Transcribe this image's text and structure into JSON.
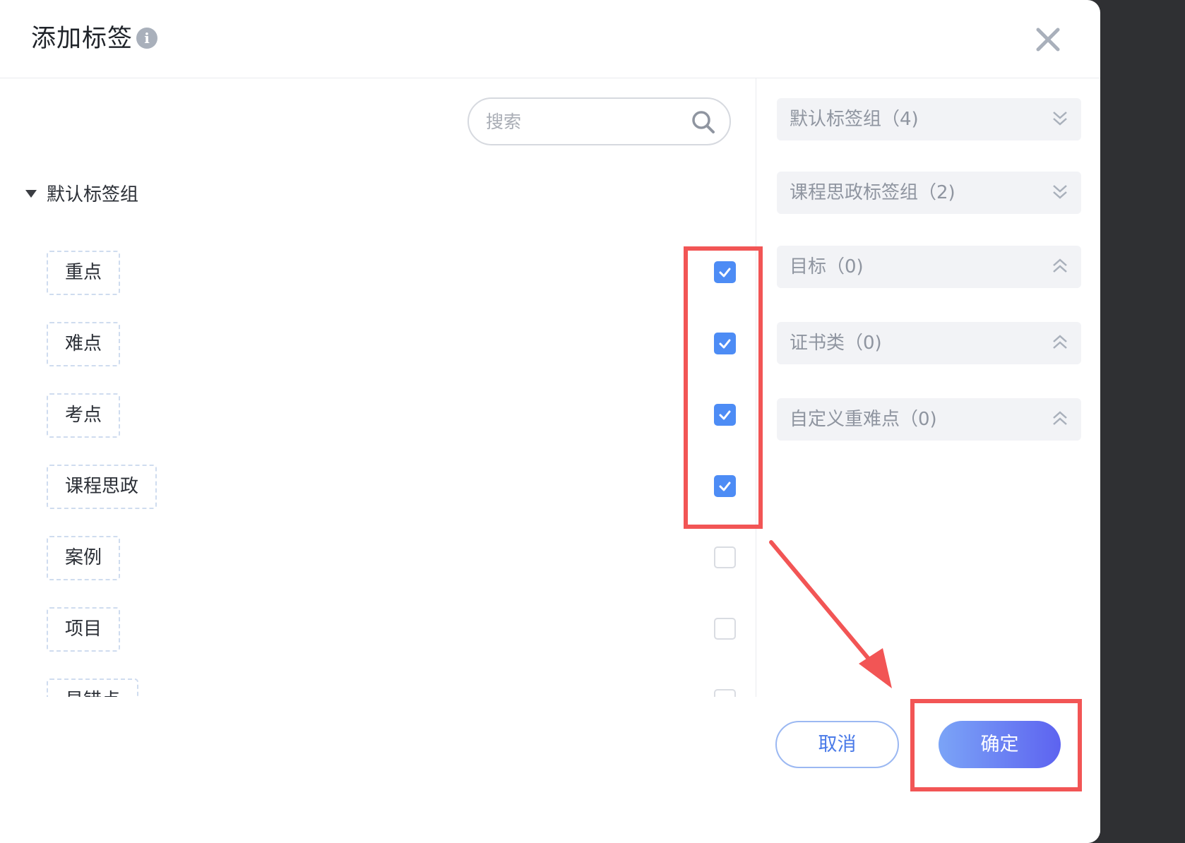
{
  "dialog": {
    "title": "添加标签",
    "info_icon": "info-icon",
    "close_icon": "close-icon"
  },
  "search": {
    "placeholder": "搜索",
    "value": ""
  },
  "group": {
    "label": "默认标签组",
    "expanded": true
  },
  "tags": [
    {
      "label": "重点",
      "checked": true
    },
    {
      "label": "难点",
      "checked": true
    },
    {
      "label": "考点",
      "checked": true
    },
    {
      "label": "课程思政",
      "checked": true
    },
    {
      "label": "案例",
      "checked": false
    },
    {
      "label": "项目",
      "checked": false
    },
    {
      "label": "易错点",
      "checked": false
    }
  ],
  "right_groups": [
    {
      "label": "默认标签组（4)",
      "icon": "double-chevron-down-icon"
    },
    {
      "label": "课程思政标签组（2)",
      "icon": "double-chevron-down-icon"
    },
    {
      "label": "目标（0)",
      "icon": "double-chevron-up-icon"
    },
    {
      "label": "证书类（0)",
      "icon": "double-chevron-up-icon"
    },
    {
      "label": "自定义重难点（0)",
      "icon": "double-chevron-up-icon"
    }
  ],
  "footer": {
    "cancel_label": "取消",
    "confirm_label": "确定"
  },
  "colors": {
    "accent": "#4d8cf5",
    "annotation": "#f25555"
  }
}
